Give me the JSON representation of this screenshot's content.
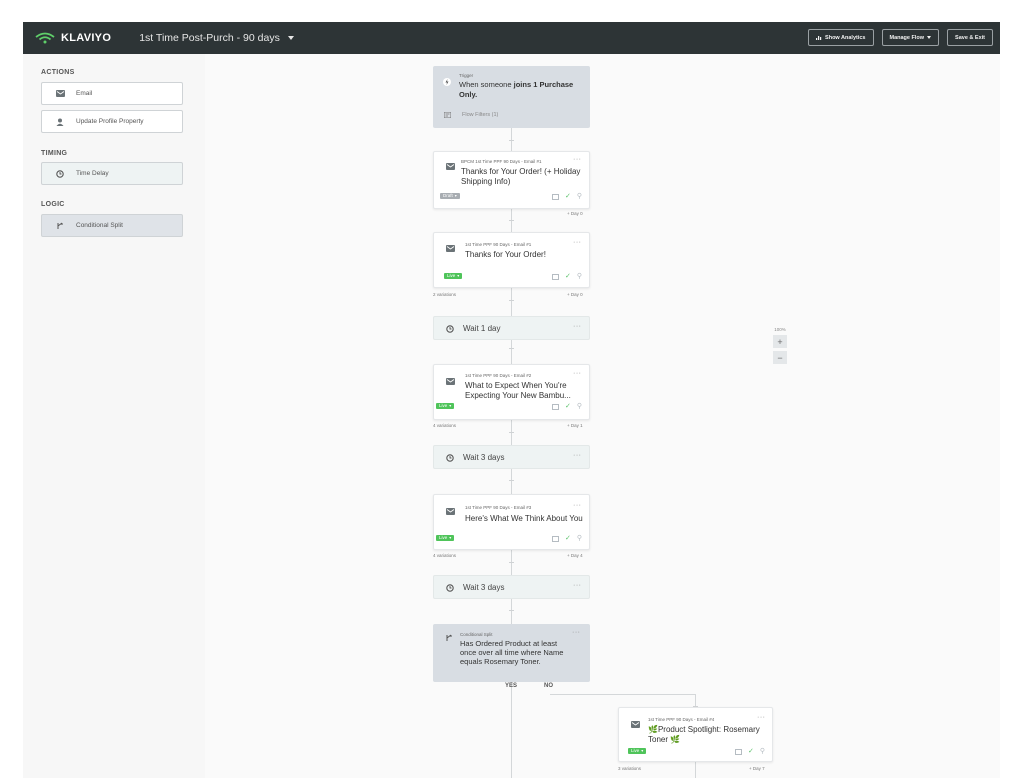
{
  "app": {
    "brand": "KLAVIYO",
    "flow_title": "1st Time Post-Purch - 90 days"
  },
  "toolbar": {
    "analytics": "Show Analytics",
    "manage": "Manage Flow",
    "save": "Save & Exit"
  },
  "sidebar": {
    "actions_title": "ACTIONS",
    "actions": [
      {
        "label": "Email",
        "icon": "envelope-icon"
      },
      {
        "label": "Update Profile Property",
        "icon": "user-icon"
      }
    ],
    "timing_title": "TIMING",
    "timing": [
      {
        "label": "Time Delay",
        "icon": "clock-icon"
      }
    ],
    "logic_title": "LOGIC",
    "logic": [
      {
        "label": "Conditional Split",
        "icon": "split-icon"
      }
    ]
  },
  "trigger": {
    "label": "Trigger",
    "text_prefix": "When someone",
    "text_bold": "joins 1 Purchase Only.",
    "filters": "Flow Filters (1)"
  },
  "emails": [
    {
      "name": "BPCM 1st Time PPF 90 Days - Email #1",
      "subject": "Thanks for Your Order! (+ Holiday Shipping Info)",
      "status": "Draft",
      "variations": "",
      "day": "Day 0"
    },
    {
      "name": "1st Time PPF 90 Days - Email #1",
      "subject": "Thanks for Your Order!",
      "status": "Live",
      "variations": "2 variations",
      "day": "Day 0"
    },
    {
      "name": "1st Time PPF 90 Days - Email #2",
      "subject": "What to Expect When You're Expecting Your New Bambu...",
      "status": "Live",
      "variations": "4 variations",
      "day": "Day 1"
    },
    {
      "name": "1st Time PPF 90 Days - Email #3",
      "subject": "Here's What We Think About You",
      "status": "Live",
      "variations": "4 variations",
      "day": "Day 4"
    },
    {
      "name": "1st Time PPF 90 Days - Email #4",
      "subject": "🌿Product Spotlight: Rosemary Toner 🌿",
      "status": "Live",
      "variations": "3 variations",
      "day": "Day 7"
    }
  ],
  "delays": [
    "Wait 1 day",
    "Wait 3 days",
    "Wait 3 days"
  ],
  "split": {
    "label": "Conditional Split",
    "text": "Has Ordered Product at least once over all time where Name equals Rosemary Toner.",
    "yes": "YES",
    "no": "NO"
  },
  "zoom": {
    "level": "100%",
    "in": "+",
    "out": "−"
  },
  "colors": {
    "topbar": "#2d3436",
    "live": "#4fc45a",
    "draft": "#a8adb2",
    "delay_bg": "#eef3f3",
    "trigger_bg": "#d8dde3"
  }
}
